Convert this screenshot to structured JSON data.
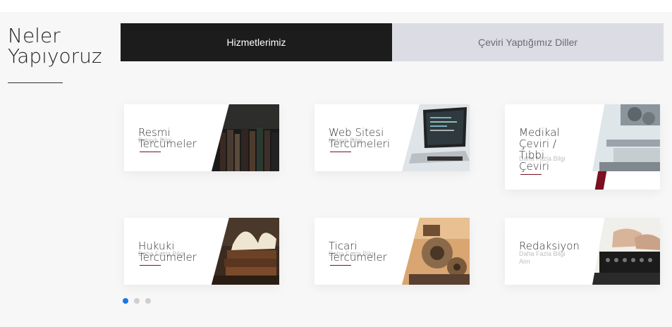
{
  "section": {
    "title_line1": "Neler",
    "title_line2": "Yapıyoruz"
  },
  "tabs": [
    {
      "label": "Hizmetlerimiz",
      "active": true
    },
    {
      "label": "Çeviri Yaptığımız Diller",
      "active": false
    }
  ],
  "cards": [
    {
      "title": "Resmi\nTercümeler",
      "more": "Detaylı Bilgi"
    },
    {
      "title": "Web Sitesi\nTercümeleri",
      "more": "Detaylı Bilgi"
    },
    {
      "title": "Medikal\nÇeviri /\nTıbbi\nÇeviri",
      "more": "Daha Fazla Bilgi"
    },
    {
      "title": "Hukuki\nTercümeler",
      "more": "Daha Fazla Bilgi"
    },
    {
      "title": "Ticari\nTercümeler",
      "more": "Daha Fazla Bilgi"
    },
    {
      "title": "Redaksiyon",
      "more": "Daha Fazla Bilgi\nAlın"
    }
  ],
  "carousel": {
    "pages": 3,
    "active_page": 1
  },
  "colors": {
    "accent": "#7a1020",
    "dot_active": "#1877e6",
    "tab_active_bg": "#1c1c1c",
    "tab_inactive_bg": "#dcdce4"
  }
}
